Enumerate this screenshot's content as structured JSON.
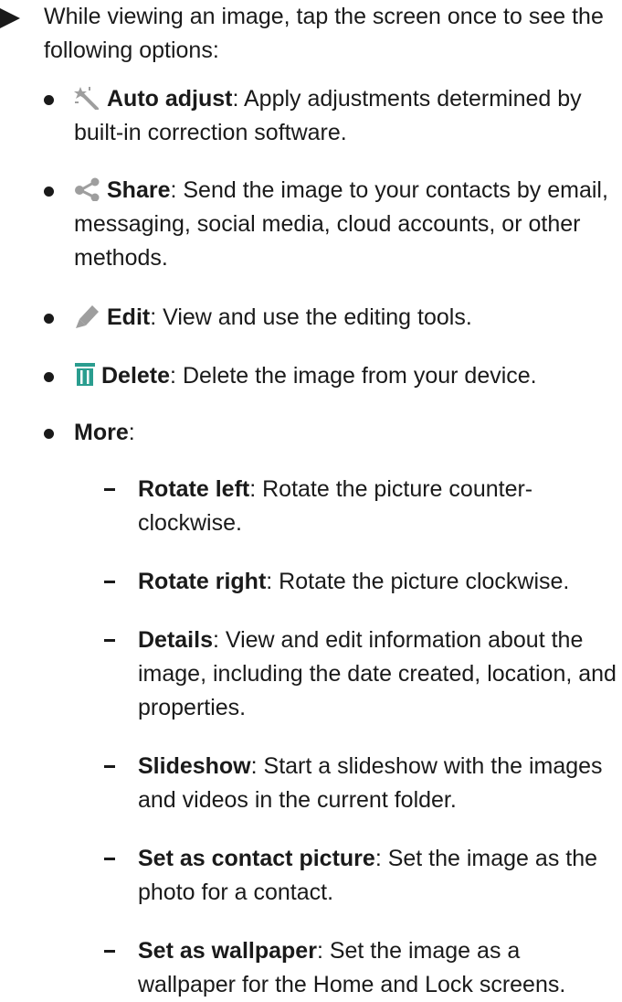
{
  "intro": "While viewing an image, tap the screen once to see the following options:",
  "options": [
    {
      "icon": "auto-adjust-wand-icon",
      "title": "Auto adjust",
      "desc": ": Apply adjustments determined by built-in correction software."
    },
    {
      "icon": "share-icon",
      "title": "Share",
      "desc": ": Send the image to your contacts by email, messaging, social media, cloud accounts, or other methods."
    },
    {
      "icon": "edit-pencil-icon",
      "title": "Edit",
      "desc": ": View and use the editing tools."
    },
    {
      "icon": "delete-trash-icon",
      "title": "Delete",
      "desc": ": Delete the image from your device."
    },
    {
      "icon": "",
      "title": "More",
      "desc": ":"
    }
  ],
  "more_options": [
    {
      "title": "Rotate left",
      "desc": ": Rotate the picture counter-clockwise."
    },
    {
      "title": "Rotate right",
      "desc": ": Rotate the picture clockwise."
    },
    {
      "title": "Details",
      "desc": ": View and edit information about the image, including the date created, location, and properties."
    },
    {
      "title": "Slideshow",
      "desc": ": Start a slideshow with the images and videos in the current folder."
    },
    {
      "title": "Set as contact picture",
      "desc": ": Set the image as the photo for a contact."
    },
    {
      "title": "Set as wallpaper",
      "desc": ": Set the image as a wallpaper for the Home and Lock screens."
    }
  ],
  "colors": {
    "text": "#1a1a1a",
    "icon_gray": "#9e9e9e",
    "delete_teal": "#2a9d8f"
  }
}
